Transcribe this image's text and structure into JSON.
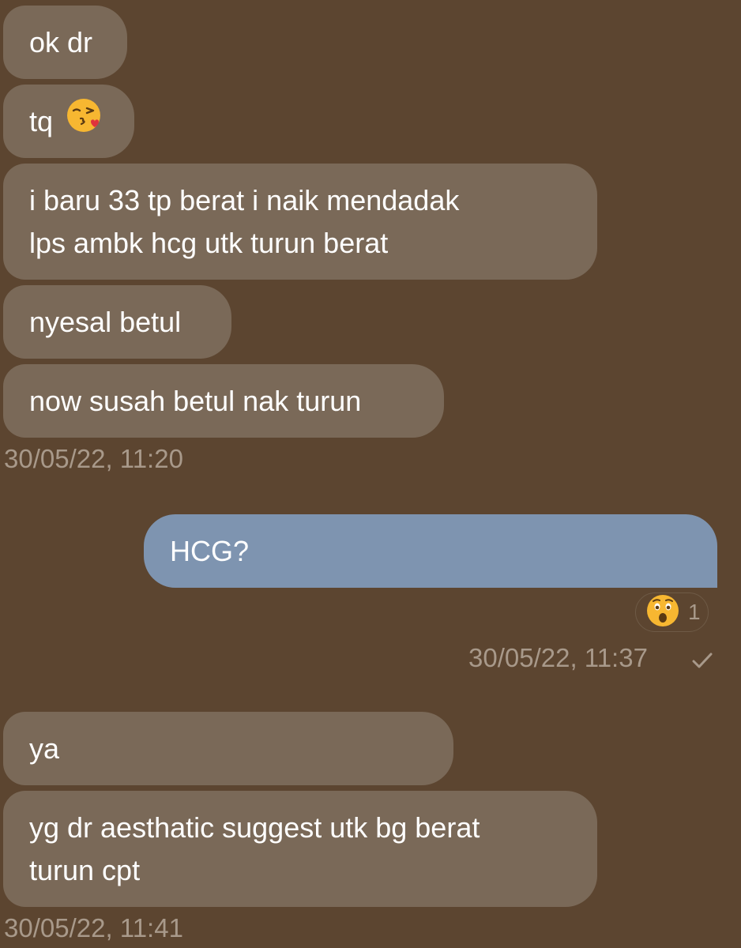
{
  "messages": [
    {
      "text": "ok dr"
    },
    {
      "text": "tq",
      "emoji": "kissing-heart-emoji"
    },
    {
      "line1": "i baru 33 tp berat i naik mendadak",
      "line2": "lps ambk hcg utk turun berat"
    },
    {
      "text": "nyesal betul"
    },
    {
      "text": "now susah betul nak turun"
    },
    {
      "text": "HCG?"
    },
    {
      "text": "ya"
    },
    {
      "line1": "yg dr aesthatic suggest utk bg berat",
      "line2": "turun cpt"
    }
  ],
  "timestamps": {
    "t1": "30/05/22, 11:20",
    "t2": "30/05/22, 11:37",
    "t3": "30/05/22, 11:41"
  },
  "reaction": {
    "emoji": "astonished-face-emoji",
    "count": "1"
  },
  "colors": {
    "background": "#5c4530",
    "incoming_bubble": "#7a6958",
    "outgoing_bubble": "#7e94b0",
    "timestamp": "#a8998a"
  }
}
